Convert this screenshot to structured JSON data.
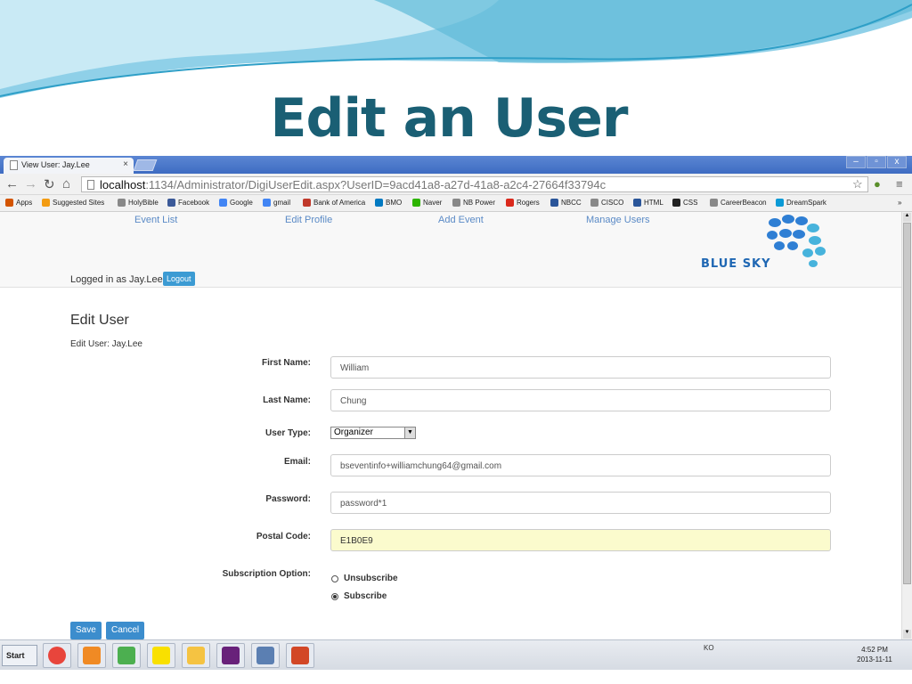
{
  "slide": {
    "title": "Edit an User"
  },
  "browser": {
    "tab_title": "View User: Jay.Lee",
    "tab_close": "×",
    "window_buttons": [
      "–",
      "▫",
      "x"
    ],
    "url_host": "localhost",
    "url_rest": ":1134/Administrator/DigiUserEdit.aspx?UserID=9acd41a8-a27d-41a8-a2c4-27664f33794c",
    "bookmarks": [
      {
        "label": "Apps",
        "color": "#d35400"
      },
      {
        "label": "Suggested Sites",
        "color": "#f39c12"
      },
      {
        "label": "HolyBible",
        "color": "#888888"
      },
      {
        "label": "Facebook",
        "color": "#3b5998"
      },
      {
        "label": "Google",
        "color": "#4285f4"
      },
      {
        "label": "gmail",
        "color": "#4285f4"
      },
      {
        "label": "Bank of America",
        "color": "#c0392b"
      },
      {
        "label": "BMO",
        "color": "#0079c1"
      },
      {
        "label": "Naver",
        "color": "#2db400"
      },
      {
        "label": "NB Power",
        "color": "#888888"
      },
      {
        "label": "Rogers",
        "color": "#da291c"
      },
      {
        "label": "NBCC",
        "color": "#2a5599"
      },
      {
        "label": "CISCO",
        "color": "#888888"
      },
      {
        "label": "HTML",
        "color": "#2a5599"
      },
      {
        "label": "CSS",
        "color": "#222222"
      },
      {
        "label": "CareerBeacon",
        "color": "#888888"
      },
      {
        "label": "DreamSpark",
        "color": "#0a9ad6"
      }
    ],
    "bookmarks_more": "»"
  },
  "site": {
    "nav": [
      "Event List",
      "Edit Profile",
      "Add Event",
      "Manage Users"
    ],
    "logged_in_text": "Logged in as Jay.Lee",
    "logout_label": "Logout",
    "logo_text": "BLUE SKY"
  },
  "form": {
    "heading": "Edit User",
    "subheading": "Edit User: Jay.Lee",
    "first_name_label": "First Name:",
    "first_name_value": "William",
    "last_name_label": "Last Name:",
    "last_name_value": "Chung",
    "user_type_label": "User Type:",
    "user_type_value": "Organizer",
    "email_label": "Email:",
    "email_value": "bseventinfo+williamchung64@gmail.com",
    "password_label": "Password:",
    "password_value": "password*1",
    "postal_label": "Postal Code:",
    "postal_value": "E1B0E9",
    "subscription_label": "Subscription Option:",
    "opt_unsubscribe": "Unsubscribe",
    "opt_subscribe": "Subscribe",
    "selected_option": "Subscribe",
    "save_label": "Save",
    "cancel_label": "Cancel"
  },
  "taskbar": {
    "start_label": "Start",
    "lang": "KO",
    "time": "4:52 PM",
    "date": "2013-11-11",
    "apps": [
      {
        "name": "chrome",
        "color": "#e8453c"
      },
      {
        "name": "settings",
        "color": "#f08a24"
      },
      {
        "name": "chart-app",
        "color": "#4caf50"
      },
      {
        "name": "kakaotalk",
        "color": "#f9e000"
      },
      {
        "name": "folder",
        "color": "#f5c342"
      },
      {
        "name": "visual-studio",
        "color": "#68217a"
      },
      {
        "name": "tools",
        "color": "#5b7fb2"
      },
      {
        "name": "powerpoint",
        "color": "#d24726"
      }
    ]
  }
}
